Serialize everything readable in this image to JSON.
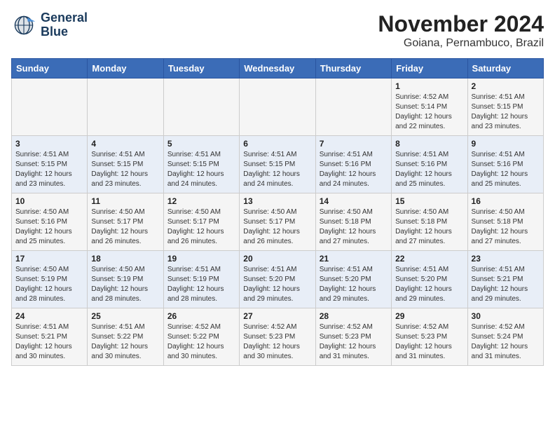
{
  "logo": {
    "line1": "General",
    "line2": "Blue"
  },
  "title": "November 2024",
  "location": "Goiana, Pernambuco, Brazil",
  "weekdays": [
    "Sunday",
    "Monday",
    "Tuesday",
    "Wednesday",
    "Thursday",
    "Friday",
    "Saturday"
  ],
  "weeks": [
    [
      {
        "day": "",
        "info": ""
      },
      {
        "day": "",
        "info": ""
      },
      {
        "day": "",
        "info": ""
      },
      {
        "day": "",
        "info": ""
      },
      {
        "day": "",
        "info": ""
      },
      {
        "day": "1",
        "info": "Sunrise: 4:52 AM\nSunset: 5:14 PM\nDaylight: 12 hours\nand 22 minutes."
      },
      {
        "day": "2",
        "info": "Sunrise: 4:51 AM\nSunset: 5:15 PM\nDaylight: 12 hours\nand 23 minutes."
      }
    ],
    [
      {
        "day": "3",
        "info": "Sunrise: 4:51 AM\nSunset: 5:15 PM\nDaylight: 12 hours\nand 23 minutes."
      },
      {
        "day": "4",
        "info": "Sunrise: 4:51 AM\nSunset: 5:15 PM\nDaylight: 12 hours\nand 23 minutes."
      },
      {
        "day": "5",
        "info": "Sunrise: 4:51 AM\nSunset: 5:15 PM\nDaylight: 12 hours\nand 24 minutes."
      },
      {
        "day": "6",
        "info": "Sunrise: 4:51 AM\nSunset: 5:15 PM\nDaylight: 12 hours\nand 24 minutes."
      },
      {
        "day": "7",
        "info": "Sunrise: 4:51 AM\nSunset: 5:16 PM\nDaylight: 12 hours\nand 24 minutes."
      },
      {
        "day": "8",
        "info": "Sunrise: 4:51 AM\nSunset: 5:16 PM\nDaylight: 12 hours\nand 25 minutes."
      },
      {
        "day": "9",
        "info": "Sunrise: 4:51 AM\nSunset: 5:16 PM\nDaylight: 12 hours\nand 25 minutes."
      }
    ],
    [
      {
        "day": "10",
        "info": "Sunrise: 4:50 AM\nSunset: 5:16 PM\nDaylight: 12 hours\nand 25 minutes."
      },
      {
        "day": "11",
        "info": "Sunrise: 4:50 AM\nSunset: 5:17 PM\nDaylight: 12 hours\nand 26 minutes."
      },
      {
        "day": "12",
        "info": "Sunrise: 4:50 AM\nSunset: 5:17 PM\nDaylight: 12 hours\nand 26 minutes."
      },
      {
        "day": "13",
        "info": "Sunrise: 4:50 AM\nSunset: 5:17 PM\nDaylight: 12 hours\nand 26 minutes."
      },
      {
        "day": "14",
        "info": "Sunrise: 4:50 AM\nSunset: 5:18 PM\nDaylight: 12 hours\nand 27 minutes."
      },
      {
        "day": "15",
        "info": "Sunrise: 4:50 AM\nSunset: 5:18 PM\nDaylight: 12 hours\nand 27 minutes."
      },
      {
        "day": "16",
        "info": "Sunrise: 4:50 AM\nSunset: 5:18 PM\nDaylight: 12 hours\nand 27 minutes."
      }
    ],
    [
      {
        "day": "17",
        "info": "Sunrise: 4:50 AM\nSunset: 5:19 PM\nDaylight: 12 hours\nand 28 minutes."
      },
      {
        "day": "18",
        "info": "Sunrise: 4:50 AM\nSunset: 5:19 PM\nDaylight: 12 hours\nand 28 minutes."
      },
      {
        "day": "19",
        "info": "Sunrise: 4:51 AM\nSunset: 5:19 PM\nDaylight: 12 hours\nand 28 minutes."
      },
      {
        "day": "20",
        "info": "Sunrise: 4:51 AM\nSunset: 5:20 PM\nDaylight: 12 hours\nand 29 minutes."
      },
      {
        "day": "21",
        "info": "Sunrise: 4:51 AM\nSunset: 5:20 PM\nDaylight: 12 hours\nand 29 minutes."
      },
      {
        "day": "22",
        "info": "Sunrise: 4:51 AM\nSunset: 5:20 PM\nDaylight: 12 hours\nand 29 minutes."
      },
      {
        "day": "23",
        "info": "Sunrise: 4:51 AM\nSunset: 5:21 PM\nDaylight: 12 hours\nand 29 minutes."
      }
    ],
    [
      {
        "day": "24",
        "info": "Sunrise: 4:51 AM\nSunset: 5:21 PM\nDaylight: 12 hours\nand 30 minutes."
      },
      {
        "day": "25",
        "info": "Sunrise: 4:51 AM\nSunset: 5:22 PM\nDaylight: 12 hours\nand 30 minutes."
      },
      {
        "day": "26",
        "info": "Sunrise: 4:52 AM\nSunset: 5:22 PM\nDaylight: 12 hours\nand 30 minutes."
      },
      {
        "day": "27",
        "info": "Sunrise: 4:52 AM\nSunset: 5:23 PM\nDaylight: 12 hours\nand 30 minutes."
      },
      {
        "day": "28",
        "info": "Sunrise: 4:52 AM\nSunset: 5:23 PM\nDaylight: 12 hours\nand 31 minutes."
      },
      {
        "day": "29",
        "info": "Sunrise: 4:52 AM\nSunset: 5:23 PM\nDaylight: 12 hours\nand 31 minutes."
      },
      {
        "day": "30",
        "info": "Sunrise: 4:52 AM\nSunset: 5:24 PM\nDaylight: 12 hours\nand 31 minutes."
      }
    ]
  ]
}
